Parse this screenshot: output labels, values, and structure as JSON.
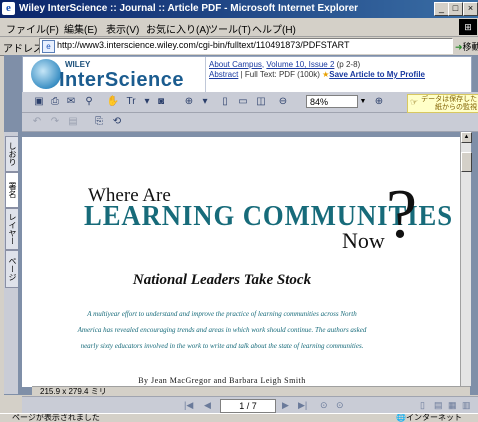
{
  "window": {
    "title": "Wiley InterScience :: Journal :: Article PDF - Microsoft Internet Explorer",
    "minimize": "_",
    "maximize": "□",
    "close": "×"
  },
  "menu": [
    "ファイル(F)",
    "編集(E)",
    "表示(V)",
    "お気に入り(A)",
    "ツール(T)",
    "ヘルプ(H)"
  ],
  "address": {
    "label": "アドレス(D)",
    "url": "http://www3.interscience.wiley.com/cgi-bin/fulltext/110491873/PDFSTART",
    "go": "移動"
  },
  "banner": {
    "wiley": "WILEY",
    "brand": "InterScience",
    "journal": "About Campus",
    "sep1": ", ",
    "volume": "Volume 10, Issue 2",
    "pages": " (p 2-8)",
    "abstract": "Abstract",
    "fulltext": " | Full Text: PDF (100k) ",
    "save": "Save Article to My Profile"
  },
  "acrobat": {
    "zoom": "84%",
    "note": "データは保存したまま紙からの監視"
  },
  "nav_tabs": [
    "しおり",
    "署名",
    "レイヤー",
    "ページ"
  ],
  "document": {
    "line1": "Where Are",
    "line2": "LEARNING COMMUNITIES",
    "line3": "Now",
    "qmark": "?",
    "subtitle": "National Leaders Take Stock",
    "abstract_lines": [
      "A multiyear effort to understand and improve the practice of learning communities across North",
      "America has revealed encouraging trends and areas in which work should continue. The authors asked",
      "nearly sixty educators involved in the work to write and talk about the state of learning communities."
    ],
    "byline": "By Jean MacGregor and Barbara Leigh Smith"
  },
  "page_size": "215.9 x 279.4 ミリ",
  "page_nav": {
    "current": "1 / 7"
  },
  "status": {
    "text": "ページが表示されました",
    "zone": "インターネット"
  }
}
